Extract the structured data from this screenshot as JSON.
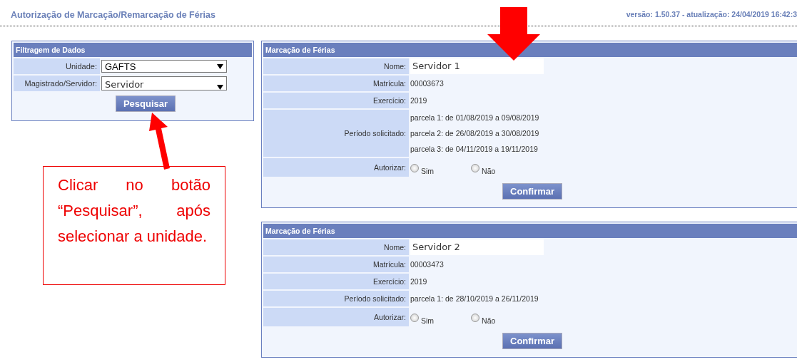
{
  "header": {
    "title": "Autorização de Marcação/Remarcação de Férias",
    "version": "versão: 1.50.37 - atualização: 24/04/2019 16:42:3"
  },
  "filter_panel": {
    "title": "Filtragem de Dados",
    "fields": [
      {
        "label": "Unidade:",
        "value": "GAFTS",
        "kind": "select"
      },
      {
        "label": "Magistrado/Servidor:",
        "value": "Servidor",
        "kind": "select-edited"
      }
    ],
    "button": "Pesquisar"
  },
  "vacation_panels": [
    {
      "title": "Marcação de Férias",
      "rows": [
        {
          "kind": "name",
          "label": "Nome:",
          "values": [
            "Servidor 1"
          ]
        },
        {
          "kind": "text",
          "label": "Matrícula:",
          "values": [
            "00003673"
          ]
        },
        {
          "kind": "text",
          "label": "Exercício:",
          "values": [
            "2019"
          ]
        },
        {
          "kind": "text",
          "label": "Período solicitado:",
          "values": [
            "parcela 1: de 01/08/2019 a 09/08/2019",
            "parcela 2: de 26/08/2019 a 30/08/2019",
            "parcela 3: de 04/11/2019 a 19/11/2019"
          ]
        },
        {
          "kind": "radio",
          "label": "Autorizar:",
          "options": [
            {
              "label": "Sim",
              "selected": false
            },
            {
              "label": "Não",
              "selected": false
            }
          ]
        }
      ],
      "button": "Confirmar"
    },
    {
      "title": "Marcação de Férias",
      "rows": [
        {
          "kind": "name",
          "label": "Nome:",
          "values": [
            "Servidor 2"
          ]
        },
        {
          "kind": "text",
          "label": "Matrícula:",
          "values": [
            "00003473"
          ]
        },
        {
          "kind": "text",
          "label": "Exercício:",
          "values": [
            "2019"
          ]
        },
        {
          "kind": "text",
          "label": "Período solicitado:",
          "values": [
            "parcela 1: de 28/10/2019 a 26/11/2019"
          ]
        },
        {
          "kind": "radio",
          "label": "Autorizar:",
          "options": [
            {
              "label": "Sim",
              "selected": false
            },
            {
              "label": "Não",
              "selected": false
            }
          ]
        }
      ],
      "button": "Confirmar"
    }
  ],
  "annotation": {
    "text": "Clicar no botão “Pesquisar”, após selecionar a unidade."
  }
}
